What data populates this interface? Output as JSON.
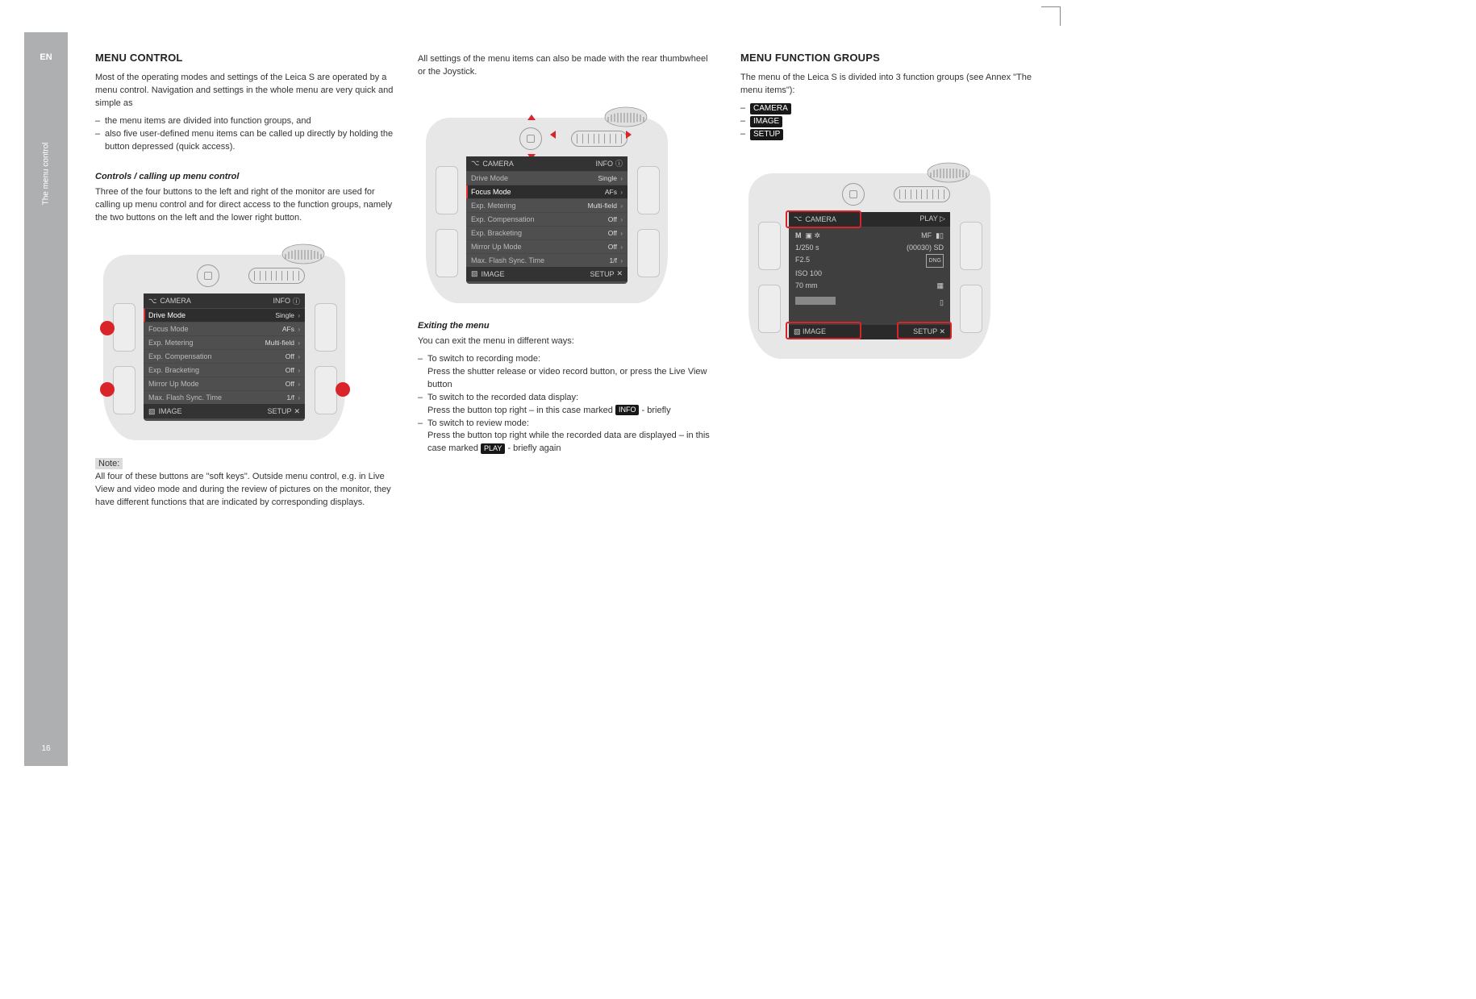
{
  "sidebar": {
    "lang": "EN",
    "label": "The menu control",
    "page": "16"
  },
  "col1": {
    "title": "MENU CONTROL",
    "intro": "Most of the operating modes and settings of the Leica S are operated by a menu control. Navigation and settings in the whole menu are very quick and simple as",
    "bullets": [
      "the menu items are divided into function groups, and",
      "also five user-defined menu items can be called up directly by holding the button depressed (quick access)."
    ],
    "sub1_title": "Controls / calling up menu control",
    "sub1_text": "Three of the four buttons to the left and right of the monitor are used for calling up menu control and for direct access to the function groups, namely the two buttons on the left and the lower right button.",
    "note_label": "Note:",
    "note_text": "All four of these buttons are \"soft keys\". Outside menu control, e.g. in Live View and video mode and during the review of pictures on the monitor, they have different functions that are indicated by corresponding displays."
  },
  "col2": {
    "intro": "All settings of the menu items can also be made with the rear thumbwheel or the Joystick.",
    "sub_title": "Exiting the menu",
    "sub_intro": "You can exit the menu in different ways:",
    "exit1_a": "To switch to recording mode:",
    "exit1_b": "Press the shutter release or video record button, or press the Live View button",
    "exit2_a": "To switch to the recorded data display:",
    "exit2_b_pre": "Press the button top right – in this case marked ",
    "exit2_pill": "INFO",
    "exit2_b_post": " - briefly",
    "exit3_a": "To switch to review mode:",
    "exit3_b_pre": "Press the button top right while the recorded data are displayed – in this case marked ",
    "exit3_pill": "PLAY",
    "exit3_b_post": " - briefly again"
  },
  "col3": {
    "title": "MENU FUNCTION GROUPS",
    "intro": "The menu of the Leica S is divided into 3 function groups (see Annex \"The menu items\"):",
    "groups": [
      "CAMERA",
      "IMAGE",
      "SETUP"
    ]
  },
  "monitor1": {
    "hdr_left": "CAMERA",
    "hdr_right": "INFO",
    "rows": [
      {
        "l": "Drive Mode",
        "v": "Single",
        "sel": true
      },
      {
        "l": "Focus Mode",
        "v": "AFs",
        "sel": false
      },
      {
        "l": "Exp. Metering",
        "v": "Multi-field",
        "sel": false
      },
      {
        "l": "Exp. Compensation",
        "v": "Off",
        "sel": false
      },
      {
        "l": "Exp. Bracketing",
        "v": "Off",
        "sel": false
      },
      {
        "l": "Mirror Up Mode",
        "v": "Off",
        "sel": false
      },
      {
        "l": "Max. Flash Sync. Time",
        "v": "1/f",
        "sel": false
      }
    ],
    "ftr_left": "IMAGE",
    "ftr_right": "SETUP"
  },
  "monitor2": {
    "hdr_left": "CAMERA",
    "hdr_right": "INFO",
    "rows": [
      {
        "l": "Drive Mode",
        "v": "Single",
        "sel": false
      },
      {
        "l": "Focus Mode",
        "v": "AFs",
        "sel": true
      },
      {
        "l": "Exp. Metering",
        "v": "Multi-field",
        "sel": false
      },
      {
        "l": "Exp. Compensation",
        "v": "Off",
        "sel": false
      },
      {
        "l": "Exp. Bracketing",
        "v": "Off",
        "sel": false
      },
      {
        "l": "Mirror Up Mode",
        "v": "Off",
        "sel": false
      },
      {
        "l": "Max. Flash Sync. Time",
        "v": "1/f",
        "sel": false
      }
    ],
    "ftr_left": "IMAGE",
    "ftr_right": "SETUP"
  },
  "monitor3": {
    "hdr_left": "CAMERA",
    "hdr_right": "PLAY",
    "mode": "M",
    "mf": "MF",
    "shutter": "1/250 s",
    "shots": "(00030) SD",
    "aperture": "F2.5",
    "dng": "DNG",
    "iso": "ISO 100",
    "focal": "70 mm",
    "ftr_left": "IMAGE",
    "ftr_right": "SETUP"
  }
}
